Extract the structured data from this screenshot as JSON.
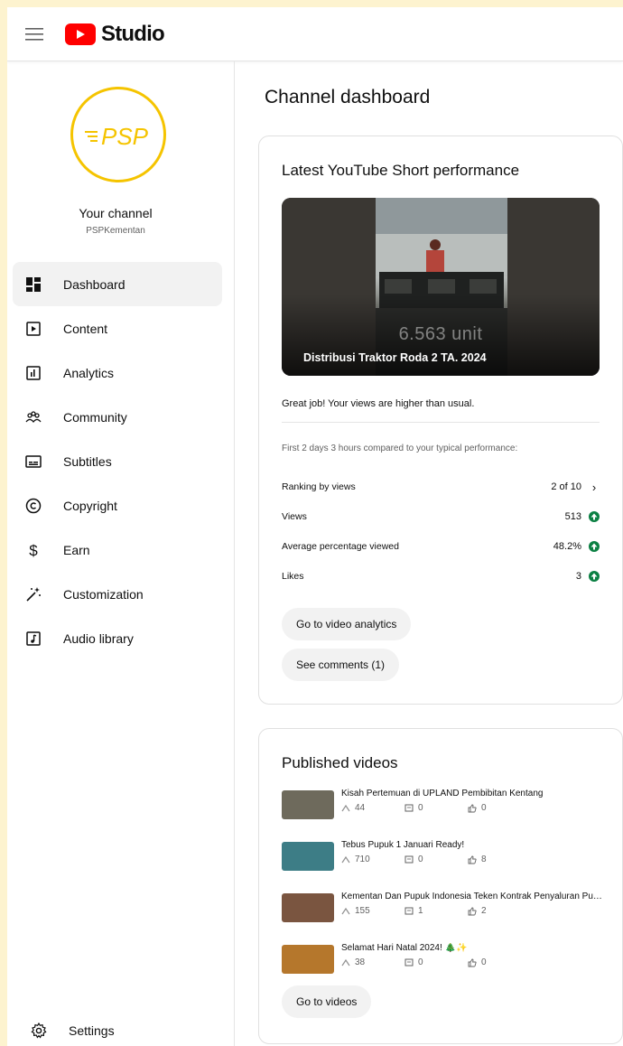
{
  "app": {
    "logo_text": "Studio",
    "accent": "#ff0000"
  },
  "channel": {
    "title": "Your channel",
    "handle": "PSPKementan",
    "avatar_text": "PSP",
    "avatar_ring": "#f5c400"
  },
  "nav": [
    {
      "label": "Dashboard",
      "icon": "dashboard-icon",
      "active": true
    },
    {
      "label": "Content",
      "icon": "content-icon"
    },
    {
      "label": "Analytics",
      "icon": "analytics-icon"
    },
    {
      "label": "Community",
      "icon": "community-icon"
    },
    {
      "label": "Subtitles",
      "icon": "subtitles-icon"
    },
    {
      "label": "Copyright",
      "icon": "copyright-icon"
    },
    {
      "label": "Earn",
      "icon": "earn-icon"
    },
    {
      "label": "Customization",
      "icon": "customization-icon"
    },
    {
      "label": "Audio library",
      "icon": "audio-library-icon"
    }
  ],
  "settings": {
    "label": "Settings",
    "icon": "gear-icon"
  },
  "page": {
    "title": "Channel dashboard"
  },
  "short_card": {
    "title": "Latest YouTube Short performance",
    "thumb_overlay": "6.563 unit",
    "thumb_title": "Distribusi Traktor Roda 2 TA. 2024",
    "kudos": "Great job! Your views are higher than usual.",
    "compare": "First 2 days 3 hours compared to your typical performance:",
    "stats": [
      {
        "label": "Ranking by views",
        "value": "2 of 10"
      },
      {
        "label": "Views",
        "value": "513"
      },
      {
        "label": "Average percentage viewed",
        "value": "48.2%"
      },
      {
        "label": "Likes",
        "value": "3"
      }
    ],
    "analytics_button": "Go to video analytics",
    "comments_button": "See comments (1)"
  },
  "published": {
    "title": "Published videos",
    "videos": [
      {
        "title": "Kisah Pertemuan di UPLAND Pembibitan Kentang",
        "views": "44",
        "comments": "0",
        "likes": "0",
        "color": "#6e6a5c"
      },
      {
        "title": "Tebus Pupuk 1 Januari Ready!",
        "views": "710",
        "comments": "0",
        "likes": "8",
        "color": "#3d7d86"
      },
      {
        "title": "Kementan Dan Pupuk Indonesia Teken Kontrak Penyaluran Pupuk",
        "views": "155",
        "comments": "1",
        "likes": "2",
        "color": "#7a5540"
      },
      {
        "title": "Selamat Hari Natal 2024! 🎄✨",
        "views": "38",
        "comments": "0",
        "likes": "0",
        "color": "#b5772c"
      }
    ],
    "button": "Go to videos"
  }
}
